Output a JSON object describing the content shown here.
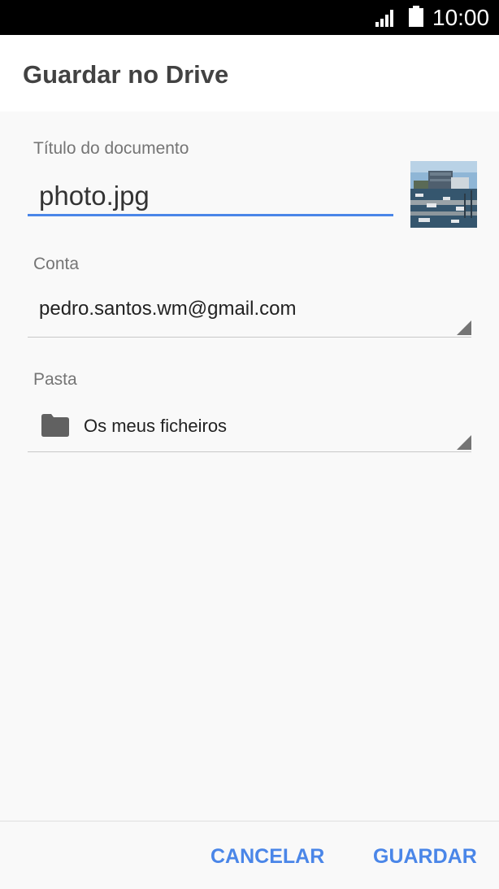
{
  "status_bar": {
    "time": "10:00",
    "icons": [
      "signal-icon",
      "battery-icon"
    ]
  },
  "header": {
    "title": "Guardar no Drive"
  },
  "form": {
    "document_title": {
      "label": "Título do documento",
      "value": "photo.jpg",
      "thumbnail": "marina-photo-thumbnail"
    },
    "account": {
      "label": "Conta",
      "value": "pedro.santos.wm@gmail.com"
    },
    "folder": {
      "label": "Pasta",
      "value": "Os meus ficheiros",
      "icon": "folder-icon"
    }
  },
  "footer": {
    "cancel_label": "CANCELAR",
    "save_label": "GUARDAR"
  },
  "colors": {
    "accent": "#4a86e8",
    "header_text": "#424242",
    "label_text": "#757575",
    "background": "#f9f9f9"
  }
}
